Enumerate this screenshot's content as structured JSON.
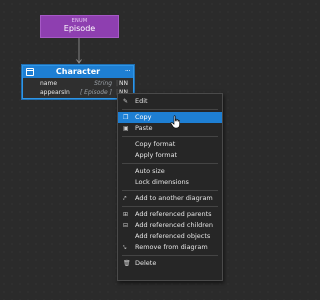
{
  "enum_node": {
    "stereotype": "ENUM",
    "name": "Episode"
  },
  "entity": {
    "name": "Character",
    "attributes": [
      {
        "name": "name",
        "type": "String",
        "nn": "NN"
      },
      {
        "name": "appearsIn",
        "type": "[ Episode ]",
        "nn": "NN"
      }
    ]
  },
  "context_menu": {
    "items": [
      {
        "label": "Edit",
        "icon": "pencil-icon"
      },
      {
        "label": "Copy",
        "icon": "copy-icon",
        "highlighted": true
      },
      {
        "label": "Paste",
        "icon": "paste-icon"
      },
      {
        "label": "Copy format",
        "icon": ""
      },
      {
        "label": "Apply format",
        "icon": ""
      },
      {
        "label": "Auto size",
        "icon": ""
      },
      {
        "label": "Lock dimensions",
        "icon": ""
      },
      {
        "label": "Add to another diagram",
        "icon": "add-diagram-icon"
      },
      {
        "label": "Add referenced parents",
        "icon": "parents-icon"
      },
      {
        "label": "Add referenced children",
        "icon": "children-icon"
      },
      {
        "label": "Add referenced objects",
        "icon": ""
      },
      {
        "label": "Remove from diagram",
        "icon": "remove-diagram-icon"
      },
      {
        "label": "Delete",
        "icon": "trash-icon"
      }
    ]
  },
  "colors": {
    "canvas": "#2b2b2b",
    "enum_fill": "#8e3fb0",
    "entity_header": "#1e7fd3",
    "menu_highlight": "#1e7fd3"
  }
}
